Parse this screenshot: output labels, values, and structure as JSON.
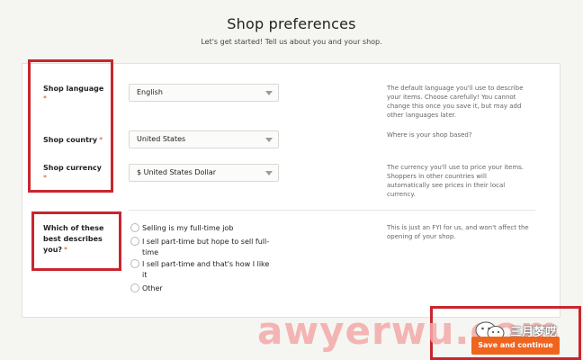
{
  "header": {
    "title": "Shop preferences",
    "subtitle": "Let's get started! Tell us about you and your shop."
  },
  "form": {
    "shop_language": {
      "label": "Shop language",
      "required": "*",
      "value": "English",
      "help": [
        "The default language you'll use to describe",
        "your items. Choose carefully! You cannot",
        "change this once you save it, but may add",
        "other languages later."
      ]
    },
    "shop_country": {
      "label": "Shop country",
      "required": "*",
      "value": "United States",
      "help": [
        "Where is your shop based?"
      ]
    },
    "shop_currency": {
      "label": "Shop currency",
      "required": "*",
      "value": "$ United States Dollar",
      "help": [
        "The currency you'll use to price your items.",
        "Shoppers in other countries will",
        "automatically see prices in their local",
        "currency."
      ]
    },
    "describes_you": {
      "label_lines": [
        "Which of these",
        "best describes",
        "you?"
      ],
      "required": "*",
      "help": [
        "This is just an FYI for us, and won't affect the",
        "opening of your shop."
      ],
      "options": [
        [
          "Selling is my full-time job"
        ],
        [
          "I sell part-time but hope to sell full-",
          "time"
        ],
        [
          "I sell part-time and that's how I like",
          "it"
        ],
        [
          "Other"
        ]
      ]
    }
  },
  "footer": {
    "save_label": "Save and continue"
  },
  "watermark": {
    "site": "awyerwu.com",
    "brand": "三月梦呓",
    "icon": "wechat-icon"
  },
  "colors": {
    "accent": "#f1641e",
    "highlight_box": "#c8262e",
    "required": "#d0532a"
  }
}
